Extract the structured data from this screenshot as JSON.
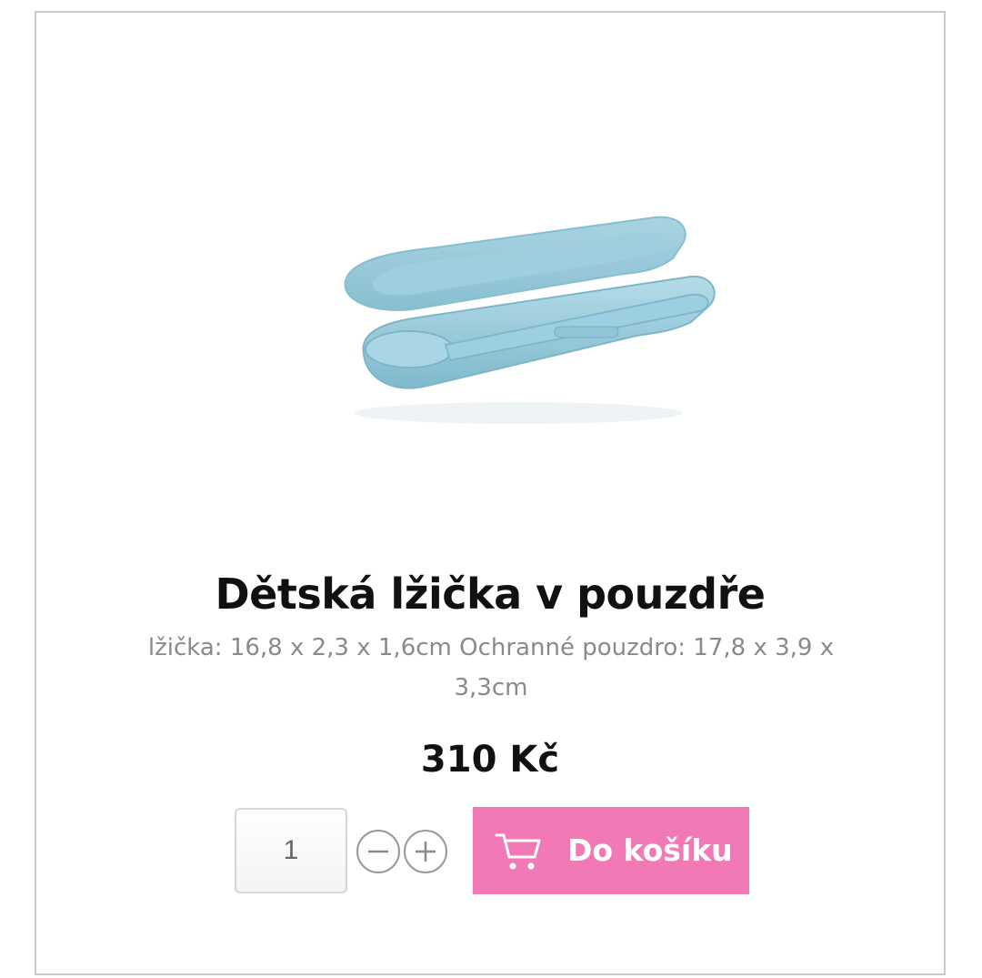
{
  "product": {
    "title": "Dětská lžička v pouzdře",
    "description": "lžička: 16,8 x 2,3 x 1,6cm Ochranné pouzdro: 17,8 x 3,9 x 3,3cm",
    "price": "310 Kč",
    "image_icon": "baby-spoon-in-case",
    "accent_color": "#8ec6d8"
  },
  "purchase": {
    "quantity": "1",
    "add_to_cart_label": "Do košíku",
    "button_color": "#f17ab6",
    "cart_icon": "shopping-cart-icon",
    "minus_icon": "minus-circle-icon",
    "plus_icon": "plus-circle-icon"
  }
}
